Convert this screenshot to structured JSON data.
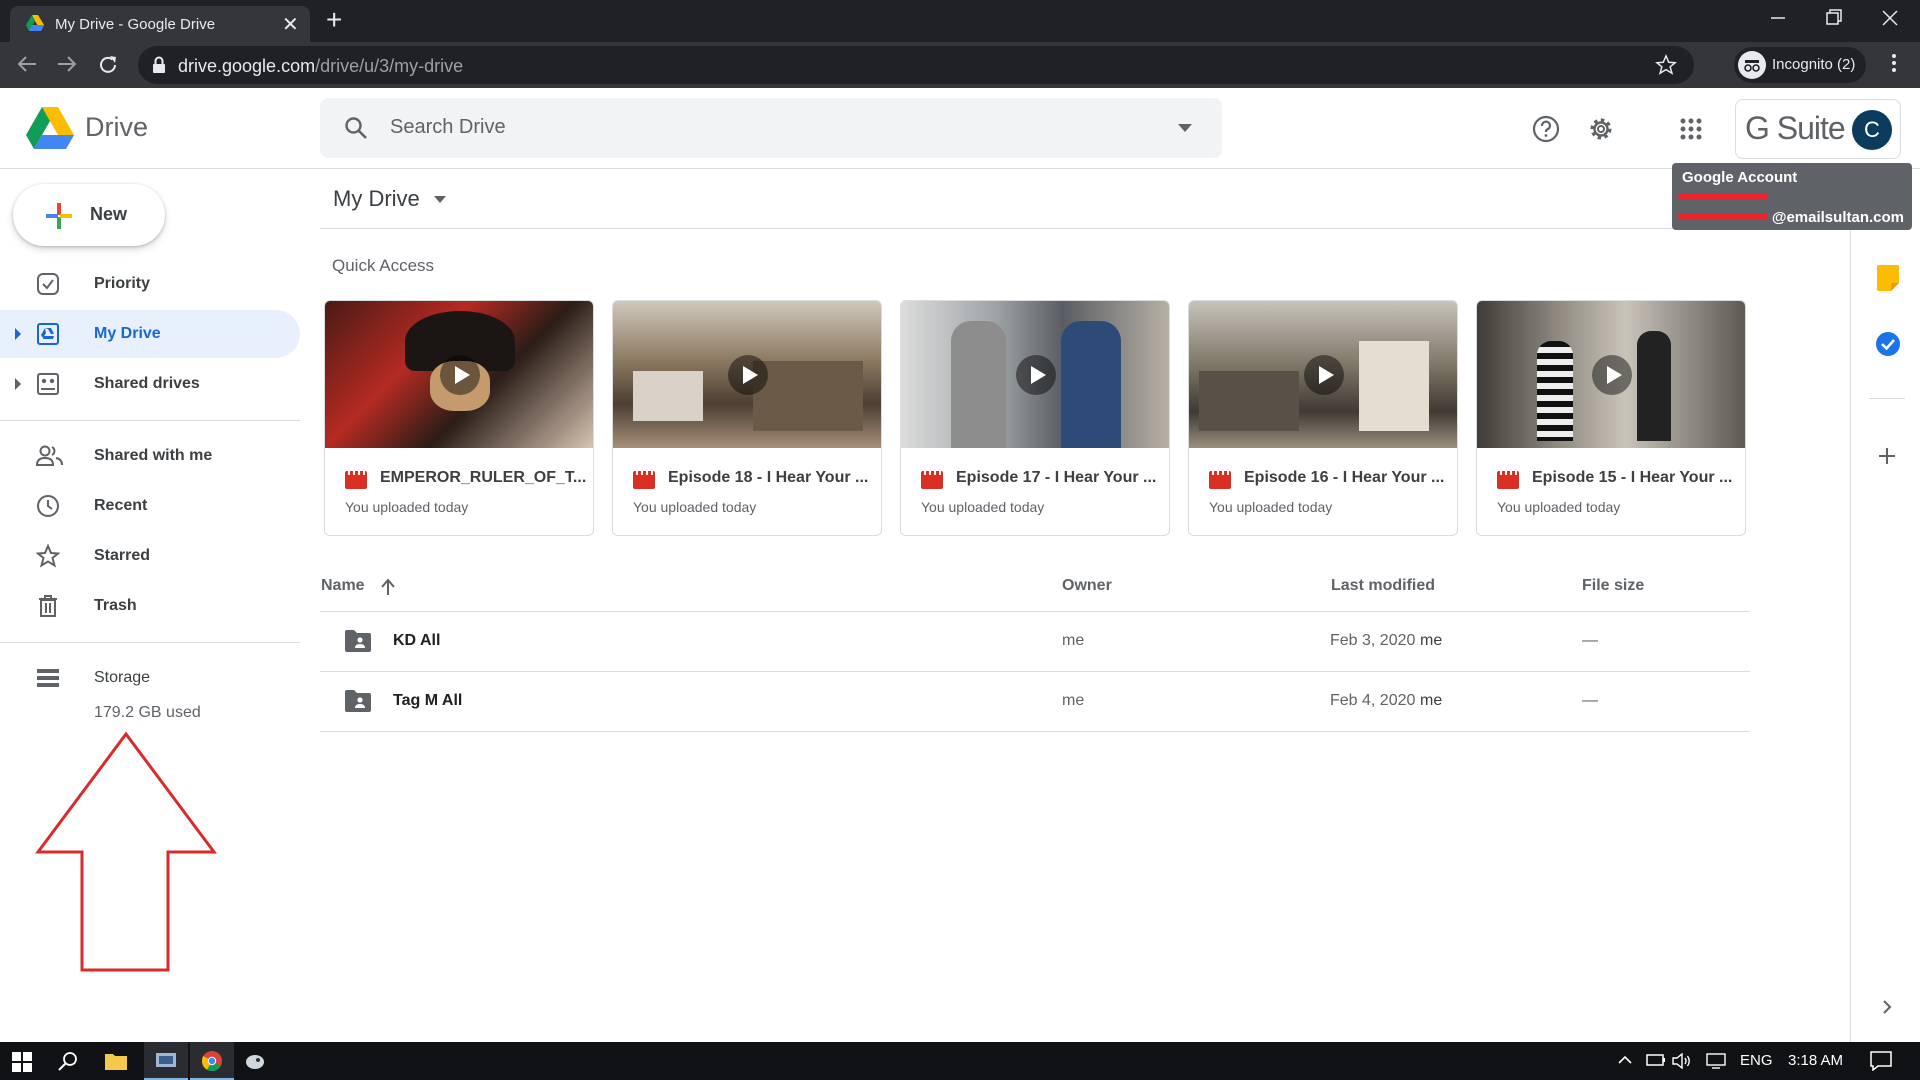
{
  "browser": {
    "tab_title": "My Drive - Google Drive",
    "tab_close": "✕",
    "new_tab": "+",
    "url_host": "drive.google.com",
    "url_path": "/drive/u/3/my-drive",
    "incognito_label": "Incognito (2)"
  },
  "header": {
    "app_name": "Drive",
    "search_placeholder": "Search Drive",
    "gsuite_label": "G Suite",
    "avatar_letter": "C"
  },
  "tooltip": {
    "title": "Google Account",
    "email_suffix": "@emailsultan.com"
  },
  "sidebar": {
    "new_label": "New",
    "items": [
      {
        "label": "Priority",
        "icon": "priority-icon"
      },
      {
        "label": "My Drive",
        "icon": "my-drive-icon"
      },
      {
        "label": "Shared drives",
        "icon": "shared-drives-icon"
      },
      {
        "label": "Shared with me",
        "icon": "people-icon"
      },
      {
        "label": "Recent",
        "icon": "clock-icon"
      },
      {
        "label": "Starred",
        "icon": "star-icon"
      },
      {
        "label": "Trash",
        "icon": "trash-icon"
      },
      {
        "label": "Storage",
        "icon": "storage-icon"
      }
    ],
    "storage_used": "179.2 GB used"
  },
  "main": {
    "title": "My Drive",
    "quick_access_label": "Quick Access",
    "quick_access": [
      {
        "title": "EMPEROR_RULER_OF_T...",
        "subtitle": "You uploaded today"
      },
      {
        "title": "Episode 18 - I Hear Your ...",
        "subtitle": "You uploaded today"
      },
      {
        "title": "Episode 17 - I Hear Your ...",
        "subtitle": "You uploaded today"
      },
      {
        "title": "Episode 16 - I Hear Your ...",
        "subtitle": "You uploaded today"
      },
      {
        "title": "Episode 15 - I Hear Your ...",
        "subtitle": "You uploaded today"
      }
    ],
    "columns": {
      "name": "Name",
      "owner": "Owner",
      "modified": "Last modified",
      "size": "File size"
    },
    "files": [
      {
        "name": "KD All",
        "owner": "me",
        "modified": "Feb 3, 2020",
        "modified_by": "me",
        "size": "—"
      },
      {
        "name": "Tag M All",
        "owner": "me",
        "modified": "Feb 4, 2020",
        "modified_by": "me",
        "size": "—"
      }
    ]
  },
  "taskbar": {
    "lang": "ENG",
    "time": "3:18 AM"
  },
  "colors": {
    "accent_blue": "#1967d2",
    "annotation_red": "#d92b2b"
  }
}
